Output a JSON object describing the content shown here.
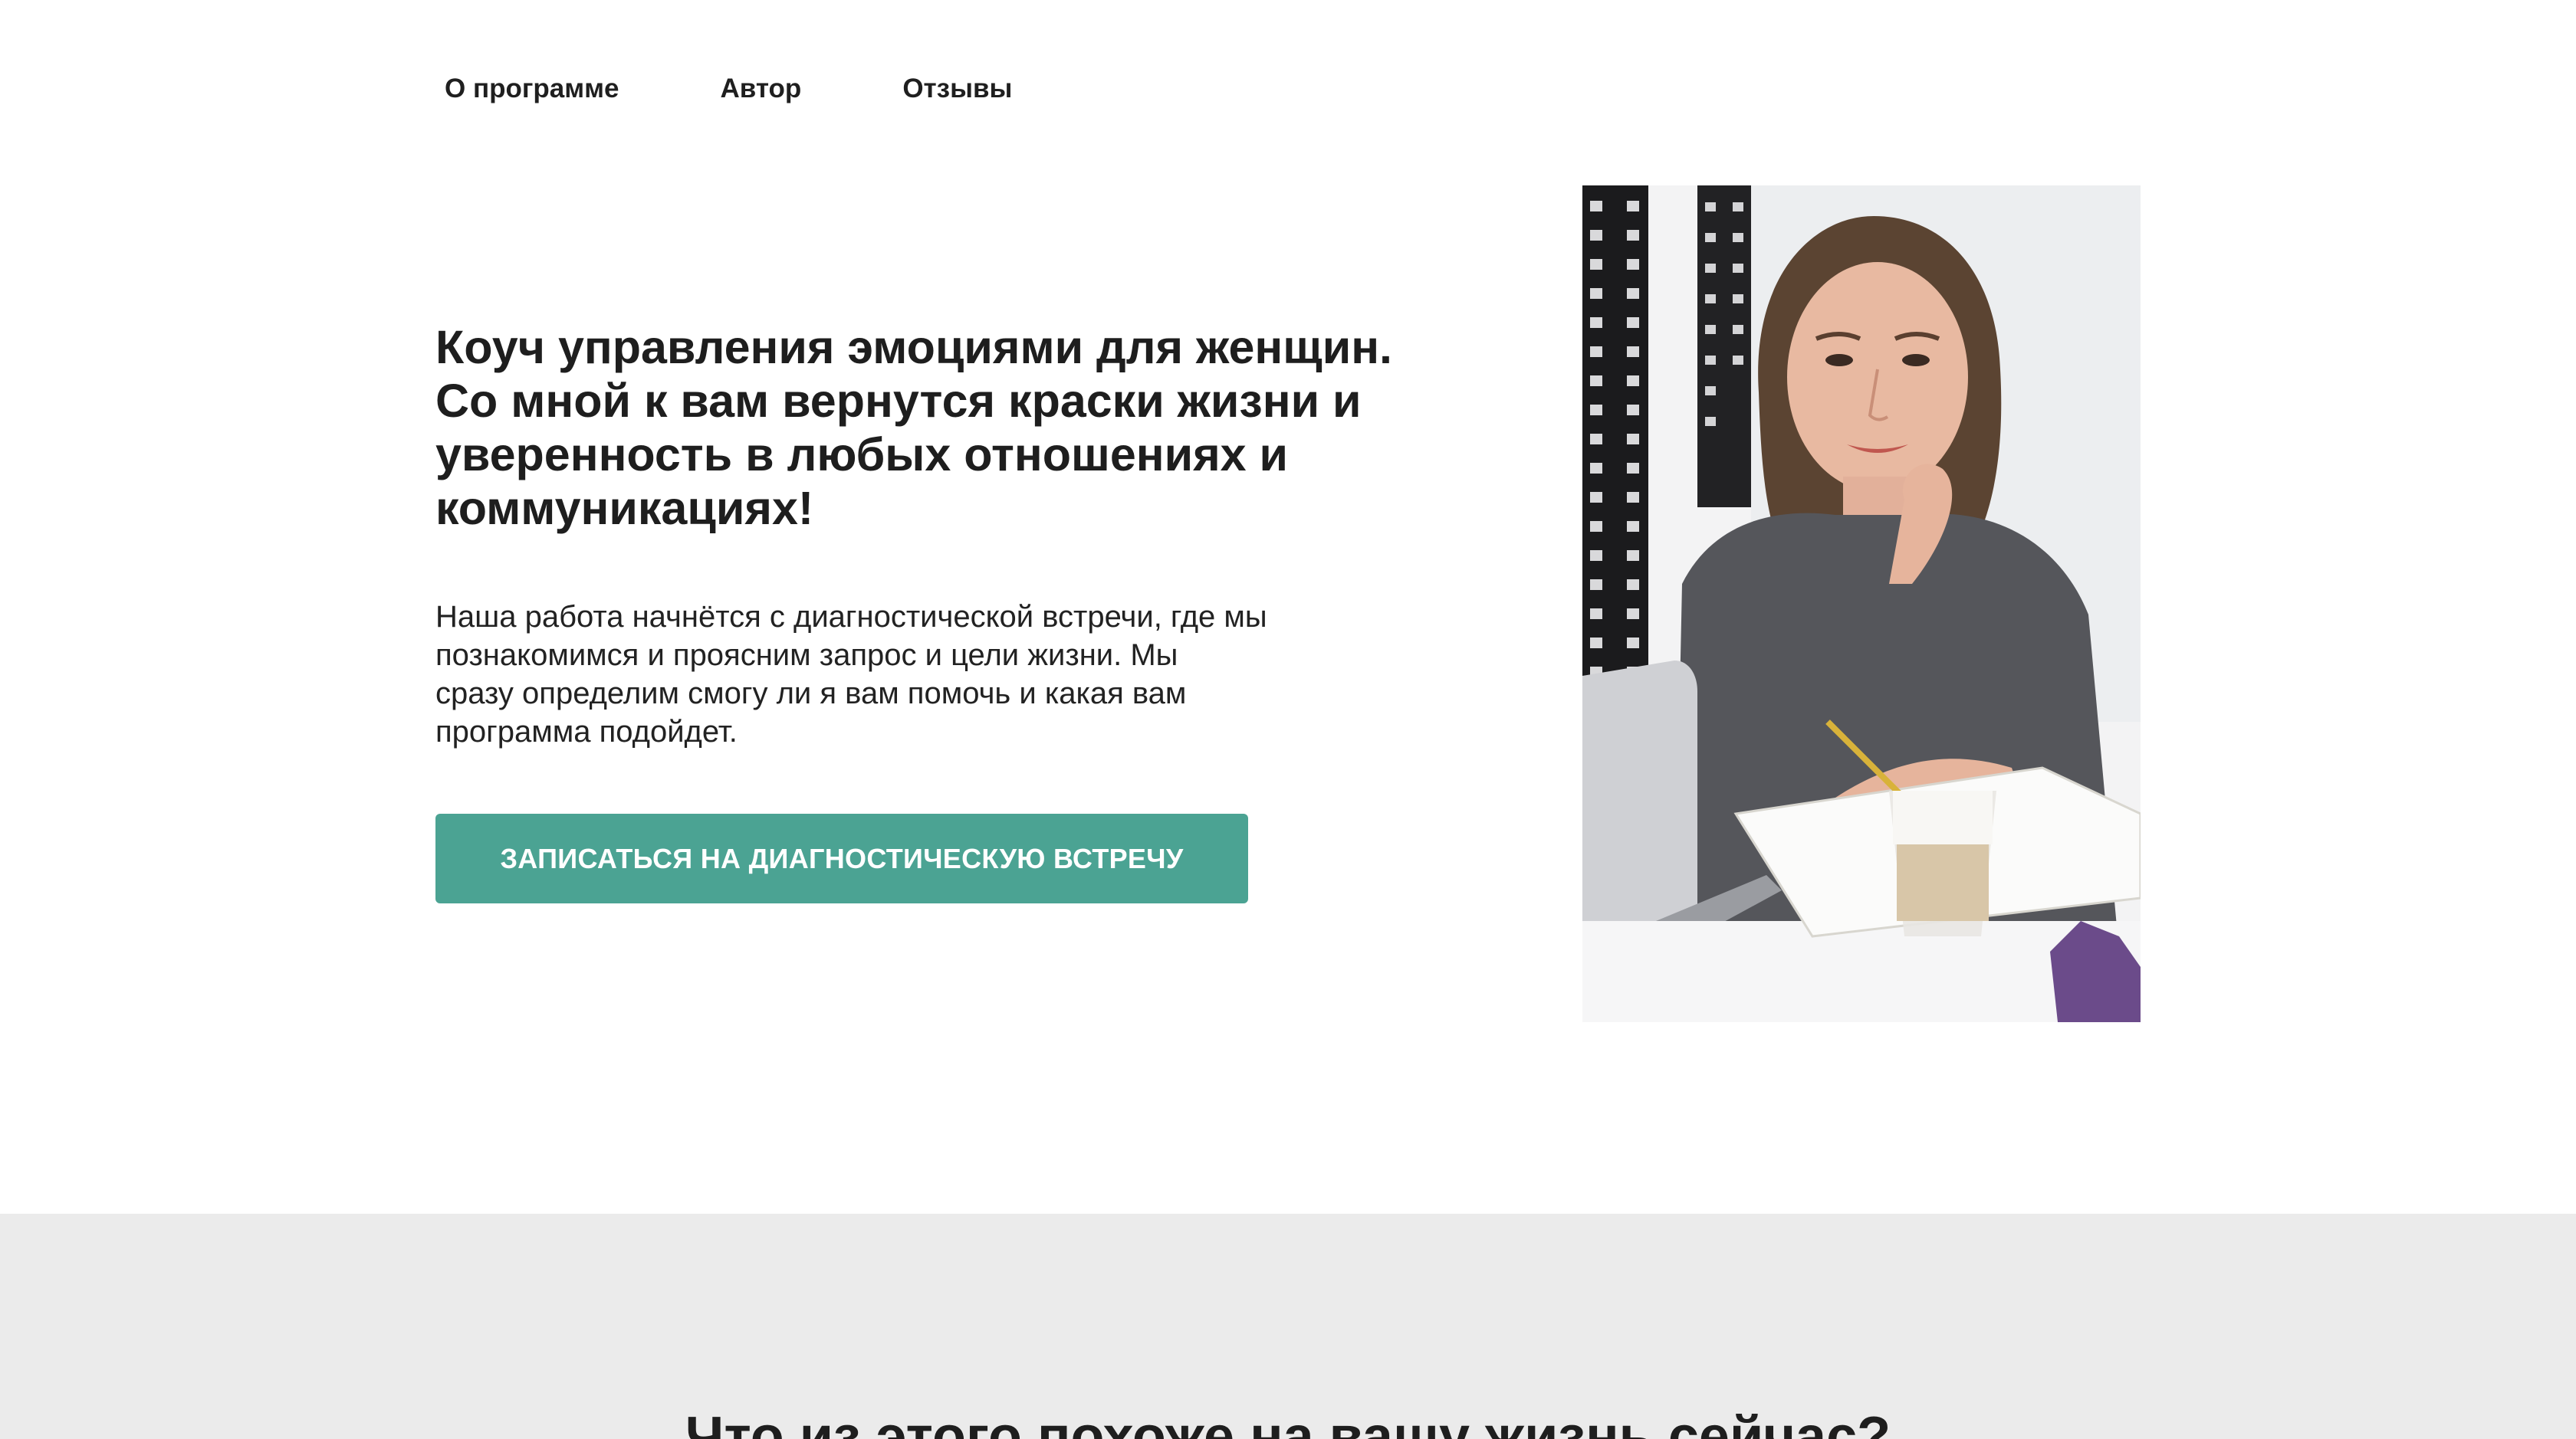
{
  "nav": {
    "items": [
      {
        "label": "О программе"
      },
      {
        "label": "Автор"
      },
      {
        "label": "Отзывы"
      }
    ]
  },
  "hero": {
    "title": "Коуч управления эмоциями для женщин.\nСо мной к вам вернутся краски жизни и\nуверенность в любых отношениях и\nкоммуникациях!",
    "text": "Наша работа начнётся с диагностической встречи, где мы\nпознакомимся и проясним запрос и цели жизни. Мы\nсразу определим смогу ли я вам помочь и какая вам\nпрограмма подойдет.",
    "cta_label": "ЗАПИСАТЬСЯ НА ДИАГНОСТИЧЕСКУЮ ВСТРЕЧУ",
    "photo_icon": "portrait-photo"
  },
  "section2": {
    "title": "Что из этого похоже на вашу жизнь сейчас?"
  },
  "colors": {
    "accent": "#4ba393",
    "section_bg": "#ebebeb",
    "text": "#1e1e1e"
  }
}
